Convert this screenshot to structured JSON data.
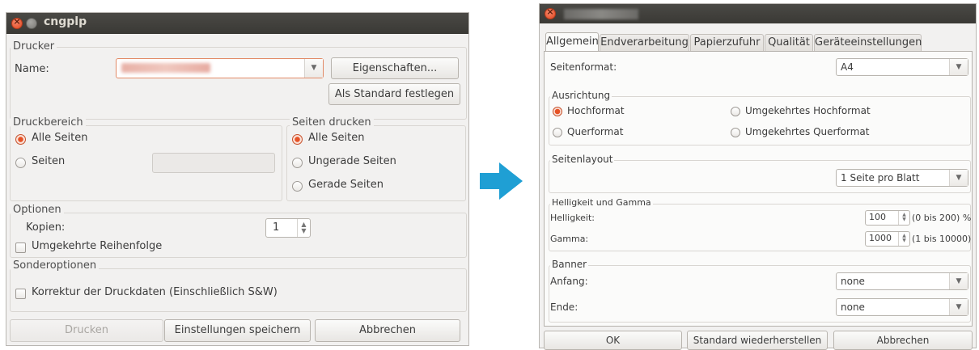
{
  "left_window": {
    "title": "cngplp",
    "printer_group": "Drucker",
    "name_label": "Name:",
    "properties_button": "Eigenschaften...",
    "set_default_button": "Als Standard festlegen",
    "print_range_group": "Druckbereich",
    "all_pages": "Alle Seiten",
    "pages": "Seiten",
    "print_pages_group": "Seiten drucken",
    "pp_all_pages": "Alle Seiten",
    "odd_pages": "Ungerade Seiten",
    "even_pages": "Gerade Seiten",
    "options_group": "Optionen",
    "copies_label": "Kopien:",
    "copies_value": "1",
    "reverse_order": "Umgekehrte Reihenfolge",
    "special_options_group": "Sonderoptionen",
    "correct_print_data": "Korrektur der Druckdaten (Einschließlich S&W)",
    "print_button": "Drucken",
    "save_settings_button": "Einstellungen speichern",
    "cancel_button": "Abbrechen"
  },
  "arrow": {
    "color": "#1f9fd4"
  },
  "right_window": {
    "tabs": [
      "Allgemein",
      "Endverarbeitung",
      "Papierzufuhr",
      "Qualität",
      "Geräteeinstellungen"
    ],
    "page_size_label": "Seitenformat:",
    "page_size_value": "A4",
    "orientation_group": "Ausrichtung",
    "portrait": "Hochformat",
    "landscape": "Querformat",
    "rev_portrait": "Umgekehrtes Hochformat",
    "rev_landscape": "Umgekehrtes Querformat",
    "layout_group": "Seitenlayout",
    "layout_value": "1 Seite pro Blatt",
    "brightness_group": "Helligkeit und Gamma",
    "brightness_label": "Helligkeit:",
    "brightness_value": "100",
    "brightness_range": "(0 bis 200) %",
    "gamma_label": "Gamma:",
    "gamma_value": "1000",
    "gamma_range": "(1 bis 10000)",
    "banner_group": "Banner",
    "start_label": "Anfang:",
    "start_value": "none",
    "end_label": "Ende:",
    "end_value": "none",
    "ok_button": "OK",
    "restore_defaults_button": "Standard wiederherstellen",
    "cancel_button": "Abbrechen"
  }
}
